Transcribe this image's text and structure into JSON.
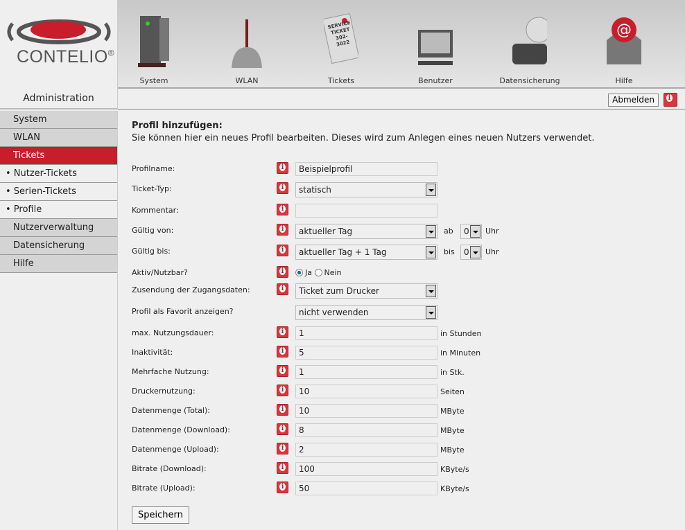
{
  "brand": {
    "name": "CONTELIO",
    "reg": "®",
    "accent": "#c81e2c"
  },
  "nav": [
    {
      "label": "System",
      "icon": "server-icon"
    },
    {
      "label": "WLAN",
      "icon": "antenna-icon"
    },
    {
      "label": "Tickets",
      "icon": "ticket-icon"
    },
    {
      "label": "Benutzer",
      "icon": "monitor-icon"
    },
    {
      "label": "Datensicherung",
      "icon": "backup-icon"
    },
    {
      "label": "Hilfe",
      "icon": "mail-help-icon"
    }
  ],
  "ticket_image_text": "SERVICE TICKET 302-3022",
  "admin": "Administration",
  "toolbar": {
    "logout": "Abmelden"
  },
  "sidebar": [
    {
      "label": "System"
    },
    {
      "label": "WLAN"
    },
    {
      "label": "Tickets"
    },
    {
      "label": "• Nutzer-Tickets"
    },
    {
      "label": "• Serien-Tickets"
    },
    {
      "label": "• Profile"
    },
    {
      "label": "Nutzerverwaltung"
    },
    {
      "label": "Datensicherung"
    },
    {
      "label": "Hilfe"
    }
  ],
  "main": {
    "title": "Profil hinzufügen:",
    "description": "Sie können hier ein neues Profil bearbeiten. Dieses wird zum Anlegen eines neuen Nutzers verwendet.",
    "fields": {
      "profilname": {
        "label": "Profilname:",
        "value": "Beispielprofil"
      },
      "tickettyp": {
        "label": "Ticket-Typ:",
        "value": "statisch"
      },
      "kommentar": {
        "label": "Kommentar:",
        "value": ""
      },
      "von": {
        "label": "Gültig von:",
        "value": "aktueller Tag",
        "sep": "ab",
        "hour": "0",
        "unit": "Uhr"
      },
      "bis": {
        "label": "Gültig bis:",
        "value": "aktueller Tag + 1 Tag",
        "sep": "bis",
        "hour": "0",
        "unit": "Uhr"
      },
      "aktiv": {
        "label": "Aktiv/Nutzbar?",
        "yes": "Ja",
        "no": "Nein",
        "selected": "Ja"
      },
      "zusendung": {
        "label": "Zusendung der Zugangsdaten:",
        "value": "Ticket zum Drucker"
      },
      "favorit": {
        "label": "Profil als Favorit anzeigen?",
        "value": "nicht verwenden"
      }
    },
    "numeric": [
      {
        "label": "max. Nutzungsdauer:",
        "value": "1",
        "unit": "in Stunden"
      },
      {
        "label": "Inaktivität:",
        "value": "5",
        "unit": "in Minuten"
      },
      {
        "label": "Mehrfache Nutzung:",
        "value": "1",
        "unit": "in Stk."
      },
      {
        "label": "Druckernutzung:",
        "value": "10",
        "unit": "Seiten"
      },
      {
        "label": "Datenmenge (Total):",
        "value": "10",
        "unit": "MByte"
      },
      {
        "label": "Datenmenge (Download):",
        "value": "8",
        "unit": "MByte"
      },
      {
        "label": "Datenmenge (Upload):",
        "value": "2",
        "unit": "MByte"
      },
      {
        "label": "Bitrate (Download):",
        "value": "100",
        "unit": "KByte/s"
      },
      {
        "label": "Bitrate (Upload):",
        "value": "50",
        "unit": "KByte/s"
      }
    ],
    "save": "Speichern"
  }
}
